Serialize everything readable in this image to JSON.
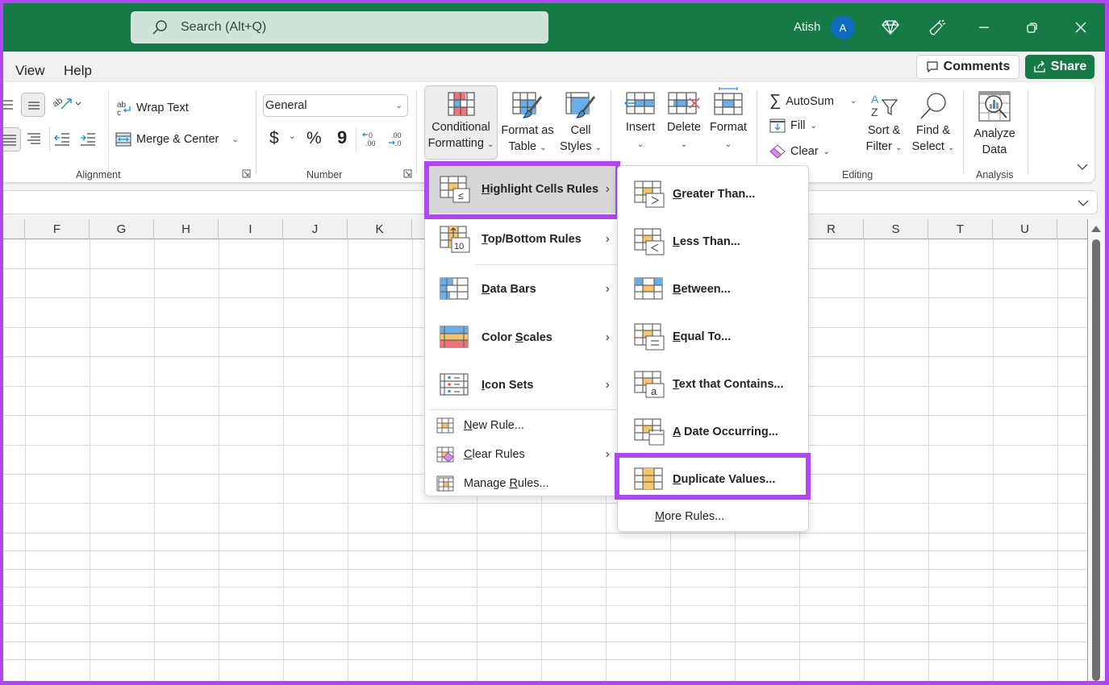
{
  "titlebar": {
    "search_placeholder": "Search (Alt+Q)",
    "user_name": "Atish",
    "avatar_initial": "A"
  },
  "menubar": {
    "tabs": [
      "View",
      "Help"
    ],
    "comments_label": "Comments",
    "share_label": "Share"
  },
  "ribbon": {
    "alignment": {
      "wrap_text": "Wrap Text",
      "merge_center": "Merge & Center",
      "group_label": "Alignment"
    },
    "number": {
      "format_value": "General",
      "currency": "$",
      "percent": "%",
      "comma": "9",
      "group_label": "Number"
    },
    "styles": {
      "conditional_formatting": [
        "Conditional",
        "Formatting"
      ],
      "format_as_table": [
        "Format as",
        "Table"
      ],
      "cell_styles": [
        "Cell",
        "Styles"
      ]
    },
    "cells": {
      "insert": "Insert",
      "delete": "Delete",
      "format": "Format"
    },
    "editing": {
      "autosum": "AutoSum",
      "fill": "Fill",
      "clear": "Clear",
      "sort_filter": [
        "Sort &",
        "Filter"
      ],
      "find_select": [
        "Find &",
        "Select"
      ],
      "group_label": "Editing"
    },
    "analysis": {
      "analyze_data": [
        "Analyze",
        "Data"
      ],
      "group_label": "Analysis"
    }
  },
  "grid": {
    "columns_left": [
      "F",
      "G",
      "H",
      "I",
      "J",
      "K"
    ],
    "columns_right": [
      "R",
      "S",
      "T",
      "U"
    ]
  },
  "cf_menu": {
    "items": [
      {
        "pre": "",
        "ul": "H",
        "post": "ighlight Cells Rules",
        "highlighted": true
      },
      {
        "pre": "",
        "ul": "T",
        "post": "op/Bottom Rules"
      },
      {
        "pre": "",
        "ul": "D",
        "post": "ata Bars"
      },
      {
        "pre": "Color ",
        "ul": "S",
        "post": "cales"
      },
      {
        "pre": "",
        "ul": "I",
        "post": "con Sets"
      }
    ],
    "small_items": [
      {
        "pre": "",
        "ul": "N",
        "post": "ew Rule..."
      },
      {
        "pre": "",
        "ul": "C",
        "post": "lear Rules"
      },
      {
        "pre": "Manage ",
        "ul": "R",
        "post": "ules..."
      }
    ]
  },
  "highlight_submenu": {
    "items": [
      {
        "pre": "",
        "ul": "G",
        "post": "reater Than..."
      },
      {
        "pre": "",
        "ul": "L",
        "post": "ess Than..."
      },
      {
        "pre": "",
        "ul": "B",
        "post": "etween..."
      },
      {
        "pre": "",
        "ul": "E",
        "post": "qual To..."
      },
      {
        "pre": "",
        "ul": "T",
        "post": "ext that Contains..."
      },
      {
        "pre": "",
        "ul": "A",
        "post": " Date Occurring..."
      },
      {
        "pre": "",
        "ul": "D",
        "post": "uplicate Values...",
        "highlighted": true
      }
    ],
    "more_rules": {
      "pre": "",
      "ul": "M",
      "post": "ore Rules..."
    }
  },
  "colors": {
    "title_green": "#157a45",
    "highlight_purple": "#b146f5",
    "accent_orange": "#f8c66a",
    "accent_blue": "#6aaee8",
    "accent_red": "#f07378"
  }
}
